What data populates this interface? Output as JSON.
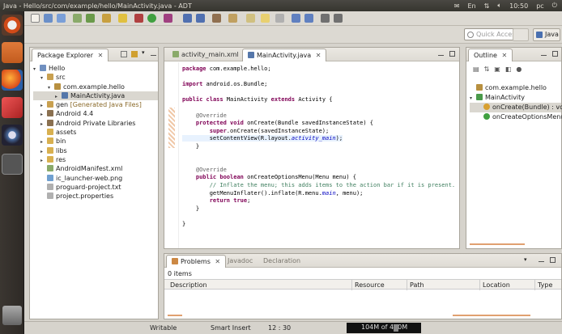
{
  "window": {
    "title": "Java - Hello/src/com/example/hello/MainActivity.java - ADT"
  },
  "system": {
    "time": "10:50",
    "user": "pc",
    "lang": "En"
  },
  "toolbar": {
    "quick_access_placeholder": "Quick Access",
    "perspective": "Java"
  },
  "explorer": {
    "tab": "Package Explorer",
    "items": [
      {
        "label": "Hello",
        "indent": 0,
        "tw": "▾",
        "icon": "project"
      },
      {
        "label": "src",
        "indent": 1,
        "tw": "▾",
        "icon": "srcfolder"
      },
      {
        "label": "com.example.hello",
        "indent": 2,
        "tw": "▾",
        "icon": "package"
      },
      {
        "label": "MainActivity.java",
        "indent": 3,
        "tw": "▸",
        "icon": "javafile",
        "selected": true
      },
      {
        "label": "gen",
        "suffix": "[Generated Java Files]",
        "indent": 1,
        "tw": "▸",
        "icon": "srcfolder"
      },
      {
        "label": "Android 4.4",
        "indent": 1,
        "tw": "▸",
        "icon": "library"
      },
      {
        "label": "Android Private Libraries",
        "indent": 1,
        "tw": "▸",
        "icon": "library"
      },
      {
        "label": "assets",
        "indent": 1,
        "tw": "",
        "icon": "folder"
      },
      {
        "label": "bin",
        "indent": 1,
        "tw": "▸",
        "icon": "folder"
      },
      {
        "label": "libs",
        "indent": 1,
        "tw": "▸",
        "icon": "folder"
      },
      {
        "label": "res",
        "indent": 1,
        "tw": "▸",
        "icon": "folder"
      },
      {
        "label": "AndroidManifest.xml",
        "indent": 1,
        "tw": "",
        "icon": "xmlfile"
      },
      {
        "label": "ic_launcher-web.png",
        "indent": 1,
        "tw": "",
        "icon": "image"
      },
      {
        "label": "proguard-project.txt",
        "indent": 1,
        "tw": "",
        "icon": "textfile"
      },
      {
        "label": "project.properties",
        "indent": 1,
        "tw": "",
        "icon": "textfile"
      }
    ]
  },
  "editor": {
    "tabs": [
      {
        "label": "activity_main.xml"
      },
      {
        "label": "MainActivity.java",
        "active": true
      }
    ],
    "lines": [
      {
        "type": "pkg",
        "kw": "package",
        "rest": " com.example.hello;"
      },
      {
        "type": "blank"
      },
      {
        "type": "import",
        "kw": "import",
        "rest": " android.os.Bundle;"
      },
      {
        "type": "blank"
      },
      {
        "type": "class",
        "kw1": "public",
        "kw2": "class",
        "name": " MainActivity ",
        "kw3": "extends",
        "rest": " Activity {"
      },
      {
        "type": "blank"
      },
      {
        "type": "anno",
        "text": "    @Override"
      },
      {
        "type": "method",
        "indent": "    ",
        "kw1": "protected",
        "kw2": "void",
        "rest": " onCreate(Bundle savedInstanceState) {"
      },
      {
        "type": "super",
        "indent": "        ",
        "kw": "super",
        "rest": ".onCreate(savedInstanceState);"
      },
      {
        "type": "setcv",
        "indent": "        ",
        "pre": "setContentView(R.layout.",
        "field": "activity_main",
        "post": ");"
      },
      {
        "type": "plain",
        "text": "    }"
      },
      {
        "type": "blank"
      },
      {
        "type": "blank"
      },
      {
        "type": "anno",
        "text": "    @Override"
      },
      {
        "type": "method",
        "indent": "    ",
        "kw1": "public",
        "kw2": "boolean",
        "rest": " onCreateOptionsMenu(Menu menu) {"
      },
      {
        "type": "comment",
        "text": "        // Inflate the menu; this adds items to the action bar if it is present."
      },
      {
        "type": "inflate",
        "indent": "        ",
        "pre": "getMenuInflater().inflate(R.menu.",
        "field": "main",
        "post": ", menu);"
      },
      {
        "type": "ret",
        "indent": "        ",
        "kw1": "return",
        "kw2": "true",
        "rest": ";"
      },
      {
        "type": "plain",
        "text": "    }"
      },
      {
        "type": "blank"
      },
      {
        "type": "plain",
        "text": "}"
      }
    ]
  },
  "outline": {
    "tab": "Outline",
    "items": [
      {
        "label": "com.example.hello",
        "indent": 0,
        "tw": "",
        "icon": "package"
      },
      {
        "label": "MainActivity",
        "indent": 0,
        "tw": "▾",
        "icon": "class"
      },
      {
        "label": "onCreate(Bundle) : voi",
        "indent": 1,
        "tw": "",
        "icon": "method-protected",
        "selected": true
      },
      {
        "label": "onCreateOptionsMenu",
        "indent": 1,
        "tw": "",
        "icon": "method-public"
      }
    ]
  },
  "problems": {
    "tabs": [
      {
        "label": "Problems",
        "active": true
      },
      {
        "label": "Javadoc"
      },
      {
        "label": "Declaration"
      }
    ],
    "count": "0 items",
    "columns": [
      "Description",
      "Resource",
      "Path",
      "Location",
      "Type"
    ]
  },
  "status": {
    "writable": "Writable",
    "insert": "Smart Insert",
    "position": "12 : 30",
    "memory": "104M of 490M",
    "memory_fraction": 0.21
  }
}
